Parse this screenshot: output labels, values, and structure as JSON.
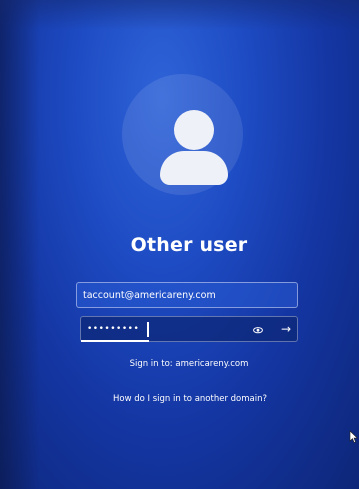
{
  "user": {
    "name": "Other user"
  },
  "email_field": {
    "value": "taccount@americareny.com"
  },
  "password_field": {
    "masked_value": "•••••••••",
    "reveal_icon": "eye-icon",
    "submit_icon": "arrow-right-icon"
  },
  "links": {
    "sign_in_to": "Sign in to: americareny.com",
    "another_domain": "How do I sign in to another domain?"
  },
  "colors": {
    "background": "#1e4cc4",
    "avatar": "#eef1f7",
    "text": "#ffffff"
  }
}
